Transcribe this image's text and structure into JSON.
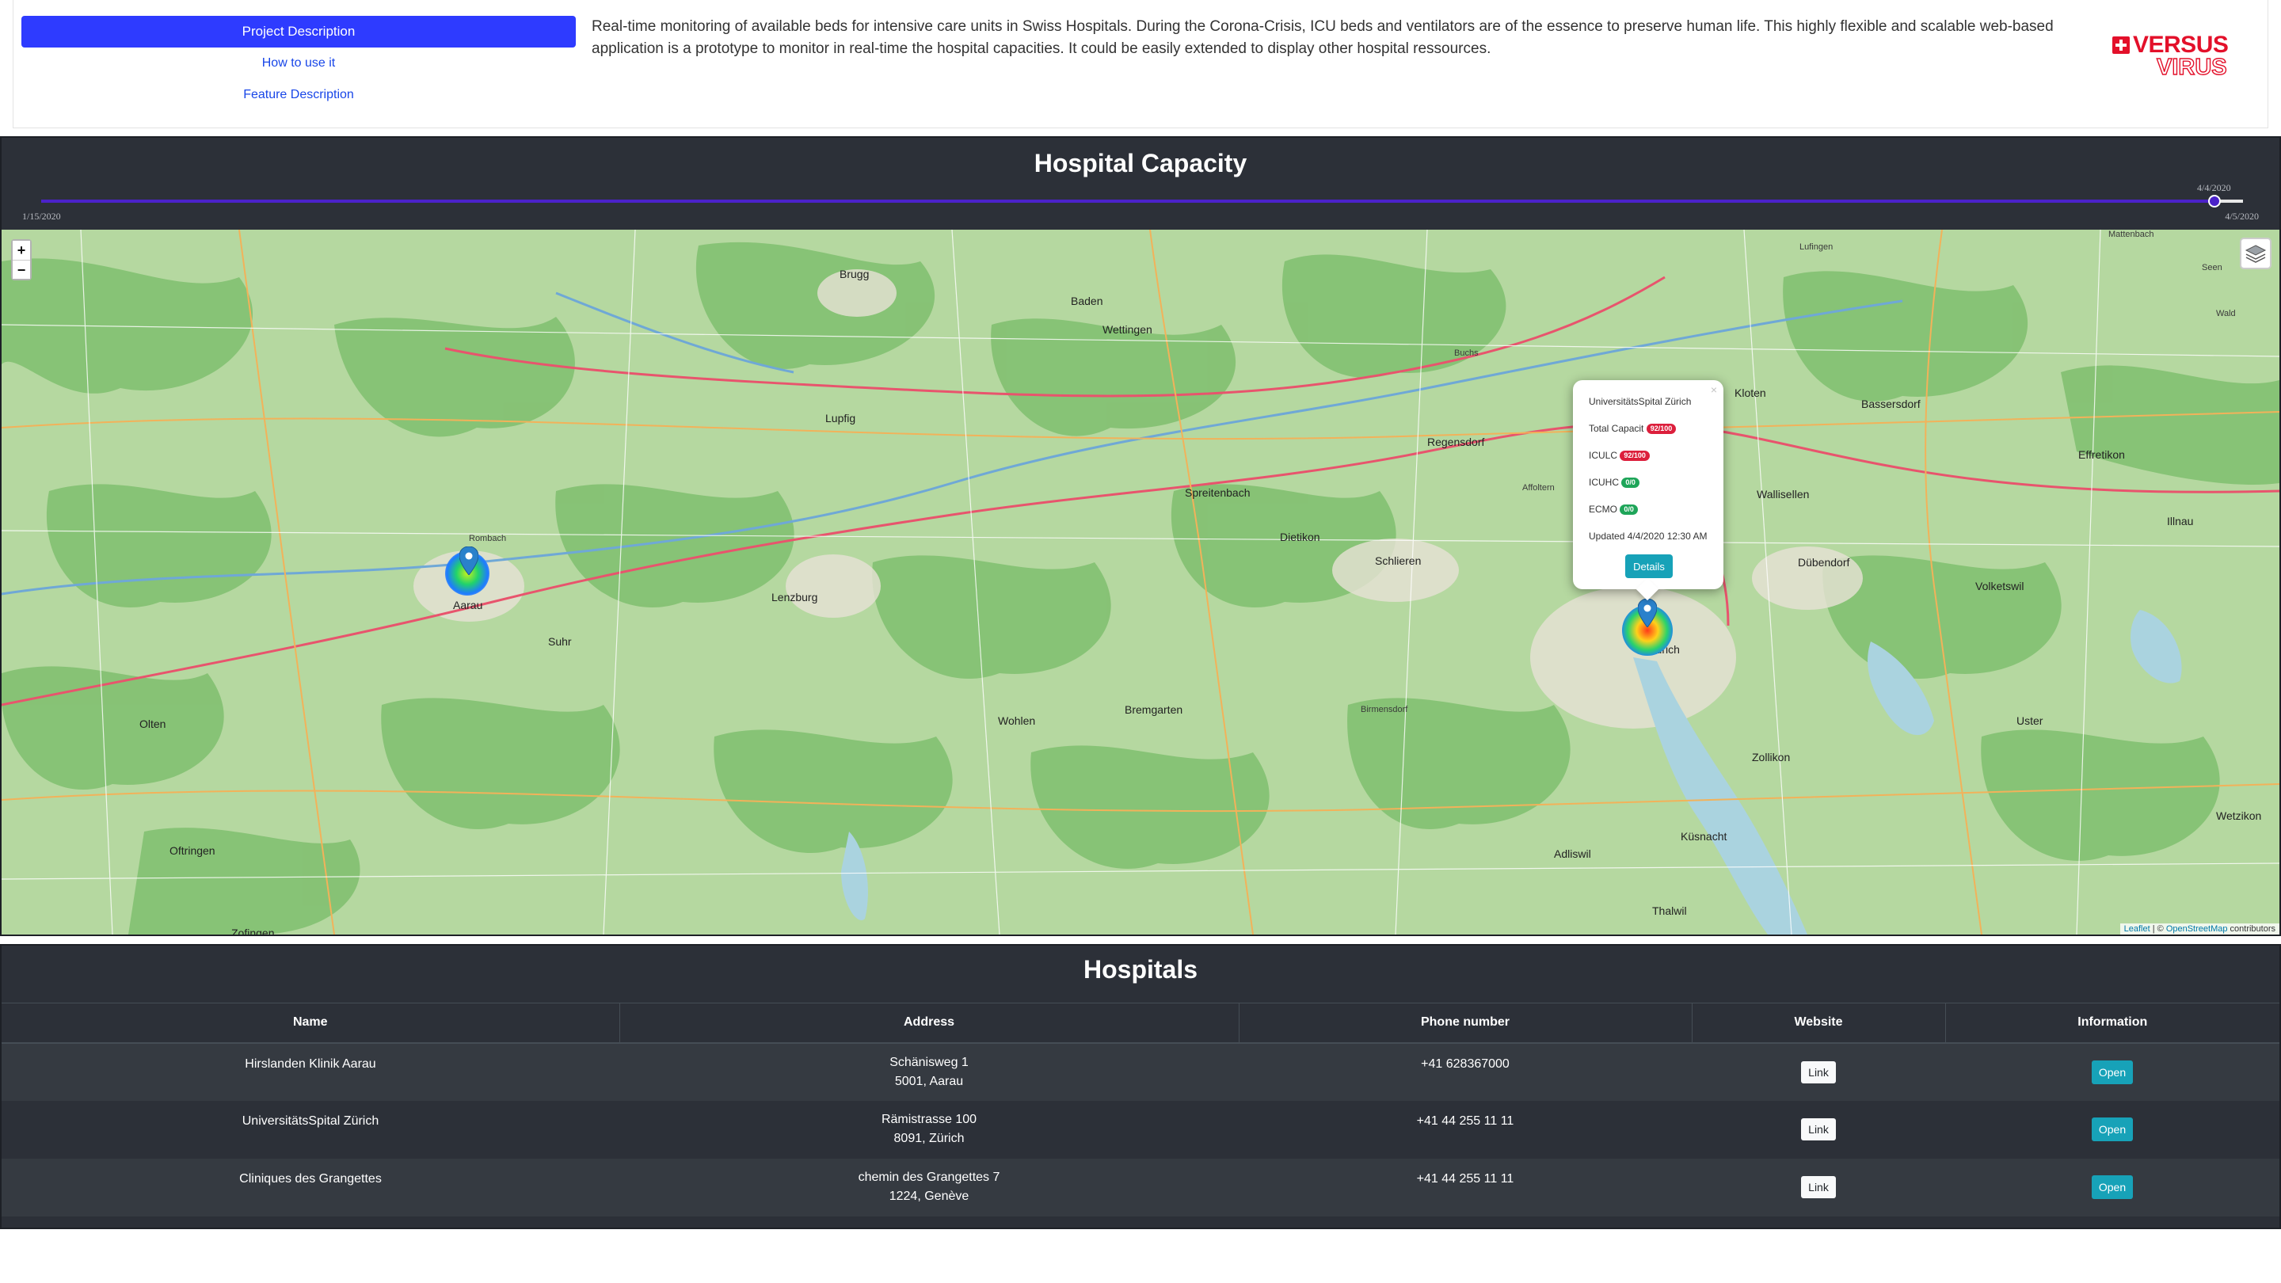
{
  "nav": {
    "project_description": "Project Description",
    "how_to_use": "How to use it",
    "feature_description": "Feature Description"
  },
  "description": "Real-time monitoring of available beds for intensive care units in Swiss Hospitals. During the Corona-Crisis, ICU beds and ventilators are of the essence to preserve human life. This highly flexible and scalable web-based application is a prototype to monitor in real-time the hospital capacities. It could be easily extended to display other hospital ressources.",
  "logo": {
    "word1": "VERSUS",
    "word2": "VIRUS"
  },
  "capacity": {
    "title": "Hospital Capacity",
    "slider": {
      "start_label": "1/15/2020",
      "end_label": "4/5/2020",
      "current_label": "4/4/2020",
      "progress": 0.985
    }
  },
  "map": {
    "zoom_in": "+",
    "zoom_out": "−",
    "attribution_leaflet": "Leaflet",
    "attribution_sep": " | © ",
    "attribution_osm": "OpenStreetMap",
    "attribution_suffix": " contributors",
    "places": {
      "brugg": "Brugg",
      "baden": "Baden",
      "wettingen": "Wettingen",
      "lupfig": "Lupfig",
      "lenzburg": "Lenzburg",
      "suhr": "Suhr",
      "aarau": "Aarau",
      "olten": "Olten",
      "zofingen": "Zofingen",
      "oftringen": "Oftringen",
      "wohlen": "Wohlen",
      "bremgarten": "Bremgarten",
      "dietikon": "Dietikon",
      "schlieren": "Schlieren",
      "regensdorf": "Regensdorf",
      "kloten": "Kloten",
      "bassersdorf": "Bassersdorf",
      "dubendorf": "Dübendorf",
      "zurich": "Zürich",
      "zollikon": "Zollikon",
      "kusnacht": "Küsnacht",
      "thalwil": "Thalwil",
      "adliswil": "Adliswil",
      "uster": "Uster",
      "volketswil": "Volketswil",
      "wetzikon": "Wetzikon",
      "effretikon": "Effretikon",
      "illnau": "Illnau",
      "spreitenbach": "Spreitenbach",
      "affoltern": "Affoltern",
      "wallisellen": "Wallisellen",
      "buchs": "Buchs",
      "rombach": "Rombach",
      "lufingen": "Lufingen",
      "mattenbach": "Mattenbach",
      "seen": "Seen",
      "wald": "Wald",
      "birmensdorf": "Birmensdorf"
    },
    "popup": {
      "title": "UniversitätsSpital Zürich",
      "total_label": "Total Capacit",
      "total_value": "92/100",
      "iculc_label": "ICULC",
      "iculc_value": "92/100",
      "icuhc_label": "ICUHC",
      "icuhc_value": "0/0",
      "ecmo_label": "ECMO",
      "ecmo_value": "0/0",
      "updated": "Updated 4/4/2020 12:30 AM",
      "details": "Details",
      "close": "×"
    }
  },
  "hospitals": {
    "title": "Hospitals",
    "columns": [
      "Name",
      "Address",
      "Phone number",
      "Website",
      "Information"
    ],
    "rows": [
      {
        "name": "Hirslanden Klinik Aarau",
        "street": "Schänisweg 1",
        "city": "5001, Aarau",
        "phone": "+41 628367000",
        "website": "Link",
        "info": "Open"
      },
      {
        "name": "UniversitätsSpital Zürich",
        "street": "Rämistrasse 100",
        "city": "8091, Zürich",
        "phone": "+41 44 255 11 11",
        "website": "Link",
        "info": "Open"
      },
      {
        "name": "Cliniques des Grangettes",
        "street": "chemin des Grangettes 7",
        "city": "1224, Genève",
        "phone": "+41 44 255 11 11",
        "website": "Link",
        "info": "Open"
      }
    ]
  },
  "colors": {
    "primary": "#2e3bff",
    "panel_bg": "#2c3038",
    "info_button": "#17a2b8",
    "badge_red": "#dc1f3c",
    "badge_green": "#1ea559",
    "slider": "#4b22c9"
  },
  "icons": {
    "layers": "layers-icon",
    "marker": "map-marker-icon",
    "logo_cross": "swiss-cross-icon"
  }
}
